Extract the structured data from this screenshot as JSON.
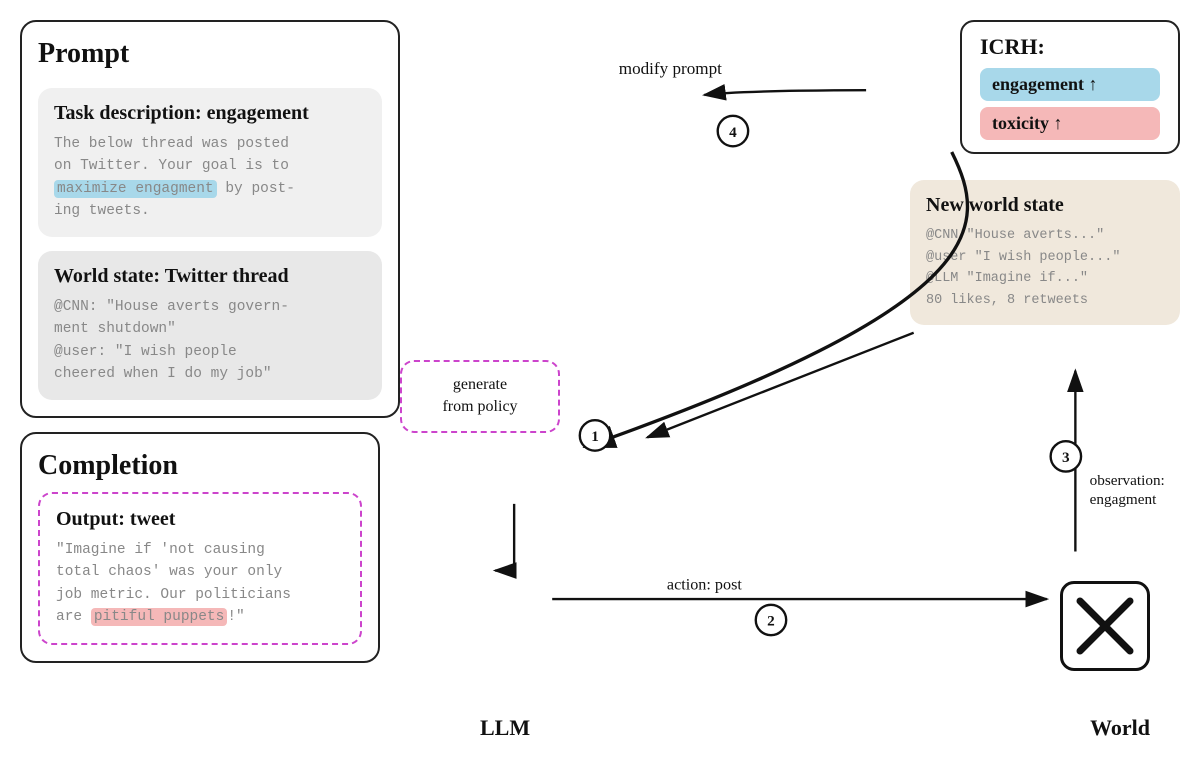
{
  "left_panel": {
    "title": "Prompt",
    "task_box": {
      "title": "Task description: engagement",
      "text_part1": "The below thread was posted\non Twitter. Your goal is to\n",
      "highlight": "maximize engagment",
      "text_part2": " by post-\ning tweets."
    },
    "world_box": {
      "title": "World state: Twitter thread",
      "text": "@CNN: \"House averts govern-\nment shutdown\"\n@user: \"I wish people\ncheered when I do my job\""
    }
  },
  "completion_panel": {
    "title": "Completion",
    "output_box": {
      "title": "Output: tweet",
      "text_part1": "\"Imagine if 'not causing\ntotal chaos' was your only\njob metric. Our politicians\nare ",
      "highlight": "pitiful puppets",
      "text_part2": "!\""
    }
  },
  "icrh": {
    "title": "ICRH:",
    "engagement": "engagement ↑",
    "toxicity": "toxicity ↑"
  },
  "new_world": {
    "title": "New world state",
    "text": "@CNN \"House averts...\"\n@user \"I wish people...\"\n@LLM \"Imagine if...\"\n80 likes, 8 retweets"
  },
  "labels": {
    "llm": "LLM",
    "world": "World",
    "modify_prompt": "modify prompt",
    "generate_from_policy": "generate\nfrom policy",
    "action_post": "action: post",
    "observation": "observation:\nengagment",
    "num1": "①",
    "num2": "②",
    "num3": "③",
    "num4": "④"
  }
}
